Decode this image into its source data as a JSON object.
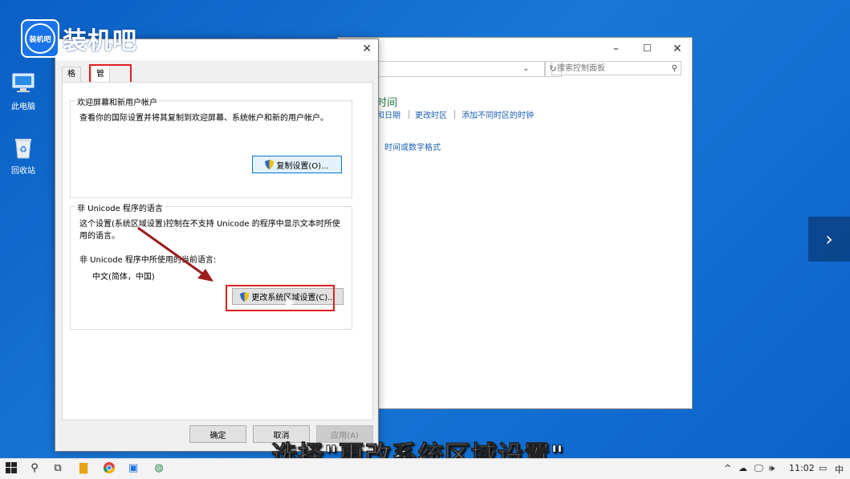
{
  "desktop": {
    "icons": [
      {
        "label": "此电脑"
      },
      {
        "label": "回收站"
      }
    ],
    "watermark": {
      "logo_small": "装机吧",
      "logo_text": "装机吧"
    }
  },
  "control_panel": {
    "search_placeholder": "搜索控制面板",
    "heading": "时间",
    "links": [
      "和日期",
      "更改时区",
      "添加不同时区的时钟",
      "时间或数字格式"
    ]
  },
  "dialog": {
    "tabs": [
      {
        "label": "格式"
      },
      {
        "label": "管理"
      }
    ],
    "active_tab": "管理",
    "group1": {
      "title": "欢迎屏幕和新用户帐户",
      "description": "查看你的国际设置并将其复制到欢迎屏幕、系统帐户和新的用户帐户。",
      "button": "复制设置(O)..."
    },
    "group2": {
      "title": "非 Unicode 程序的语言",
      "description_line1": "这个设置(系统区域设置)控制在不支持 Unicode 的程序中显示文本时所使",
      "description_line2": "用的语言。",
      "current_label": "非 Unicode 程序中所使用的当前语言:",
      "current_value": "中文(简体，中国)",
      "button": "更改系统区域设置(C)..."
    },
    "buttons": {
      "ok": "确定",
      "cancel": "取消",
      "apply": "应用(A)"
    }
  },
  "caption": "选择\"更改系统区域设置\"",
  "taskbar": {
    "time": "11:02",
    "ime": "中"
  },
  "colors": {
    "highlight": "#e02020",
    "link": "#1a5fb4",
    "arrow": "#9b1c1c"
  }
}
